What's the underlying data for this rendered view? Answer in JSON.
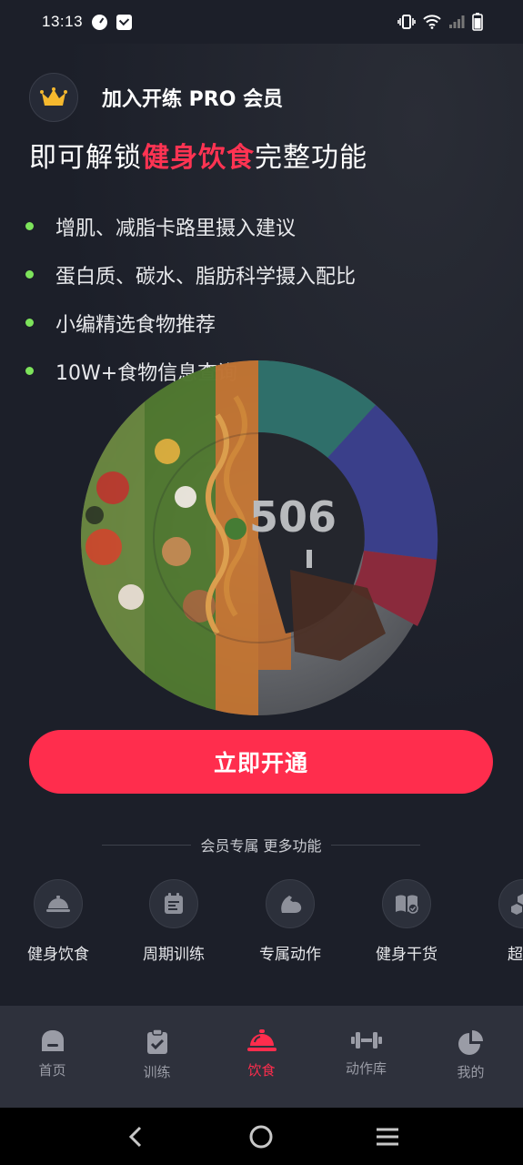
{
  "status_bar": {
    "time": "13:13"
  },
  "promo": {
    "title": "加入开练 PRO 会员",
    "headline_prefix": "即可解锁",
    "headline_accent": "健身饮食",
    "headline_suffix": "完整功能",
    "features": [
      "增肌、减脂卡路里摄入建议",
      "蛋白质、碳水、脂肪科学摄入配比",
      "小编精选食物推荐",
      "10W+食物信息查询"
    ],
    "visual_number": "506",
    "cta_label": "立即开通",
    "accent_color": "#ff2d4d",
    "bullet_color": "#7de35b"
  },
  "member_section": {
    "divider_label": "会员专属  更多功能",
    "items": [
      {
        "label": "健身饮食",
        "icon": "food-cloche-icon"
      },
      {
        "label": "周期训练",
        "icon": "calendar-plan-icon"
      },
      {
        "label": "专属动作",
        "icon": "flexed-arm-icon"
      },
      {
        "label": "健身干货",
        "icon": "book-check-icon"
      },
      {
        "label": "超级",
        "icon": "cubes-icon"
      }
    ]
  },
  "tab_bar": {
    "tabs": [
      {
        "label": "首页",
        "icon": "home-icon",
        "active": false
      },
      {
        "label": "训练",
        "icon": "clipboard-icon",
        "active": false
      },
      {
        "label": "饮食",
        "icon": "cloche-icon",
        "active": true
      },
      {
        "label": "动作库",
        "icon": "dumbbell-icon",
        "active": false
      },
      {
        "label": "我的",
        "icon": "pie-chart-icon",
        "active": false
      }
    ]
  }
}
